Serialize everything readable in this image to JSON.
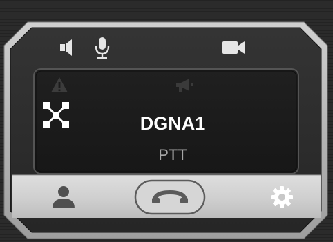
{
  "call_panel": {
    "group_name": "DGNA1",
    "mode": "PTT"
  },
  "icons": {
    "top": [
      "speaker-icon",
      "microphone-icon",
      "video-camera-icon"
    ],
    "status": [
      "warning-icon",
      "megaphone-icon",
      "group-node-icon"
    ],
    "bottom": [
      "user-icon",
      "hang-up-icon",
      "gear-icon"
    ]
  },
  "colors": {
    "frame_light": "#c9c9c9",
    "frame_dark": "#2e2e2e",
    "panel_background": "#1e1e1e",
    "text_primary": "#ffffff",
    "text_secondary": "#a7a7a7",
    "bottom_bar": "#d1d1d1",
    "bottom_icons": "#505050"
  }
}
